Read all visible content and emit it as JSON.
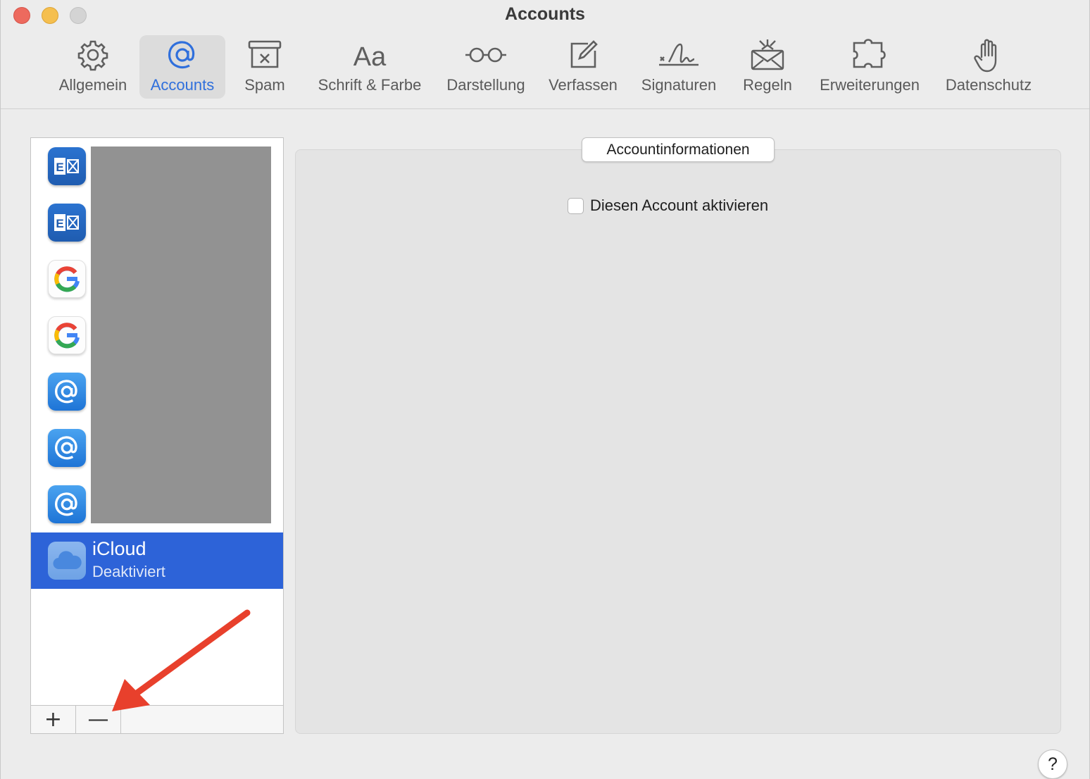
{
  "window": {
    "title": "Accounts"
  },
  "toolbar": {
    "items": [
      {
        "label": "Allgemein",
        "icon": "gear-icon"
      },
      {
        "label": "Accounts",
        "icon": "at-icon",
        "active": true
      },
      {
        "label": "Spam",
        "icon": "junk-tray-icon"
      },
      {
        "label": "Schrift & Farbe",
        "icon": "font-icon"
      },
      {
        "label": "Darstellung",
        "icon": "glasses-icon"
      },
      {
        "label": "Verfassen",
        "icon": "compose-icon"
      },
      {
        "label": "Signaturen",
        "icon": "signature-icon"
      },
      {
        "label": "Regeln",
        "icon": "rules-envelope-icon"
      },
      {
        "label": "Erweiterungen",
        "icon": "puzzle-icon"
      },
      {
        "label": "Datenschutz",
        "icon": "hand-icon"
      }
    ],
    "accent_color": "#2f6fdc"
  },
  "accounts": {
    "items": [
      {
        "icon": "exchange-icon"
      },
      {
        "icon": "exchange-icon"
      },
      {
        "icon": "google-icon"
      },
      {
        "icon": "google-icon"
      },
      {
        "icon": "mail-at-icon"
      },
      {
        "icon": "mail-at-icon"
      },
      {
        "icon": "mail-at-icon"
      }
    ],
    "selected": {
      "name": "iCloud",
      "status": "Deaktiviert",
      "icon": "icloud-icon"
    },
    "selection_color": "#2d63d8",
    "add_label": "+",
    "remove_label": "—"
  },
  "detail": {
    "tab_label": "Accountinformationen",
    "enable_checkbox_label": "Diesen Account aktivieren",
    "enable_checked": false
  },
  "help_label": "?",
  "annotation_color": "#e8402c"
}
